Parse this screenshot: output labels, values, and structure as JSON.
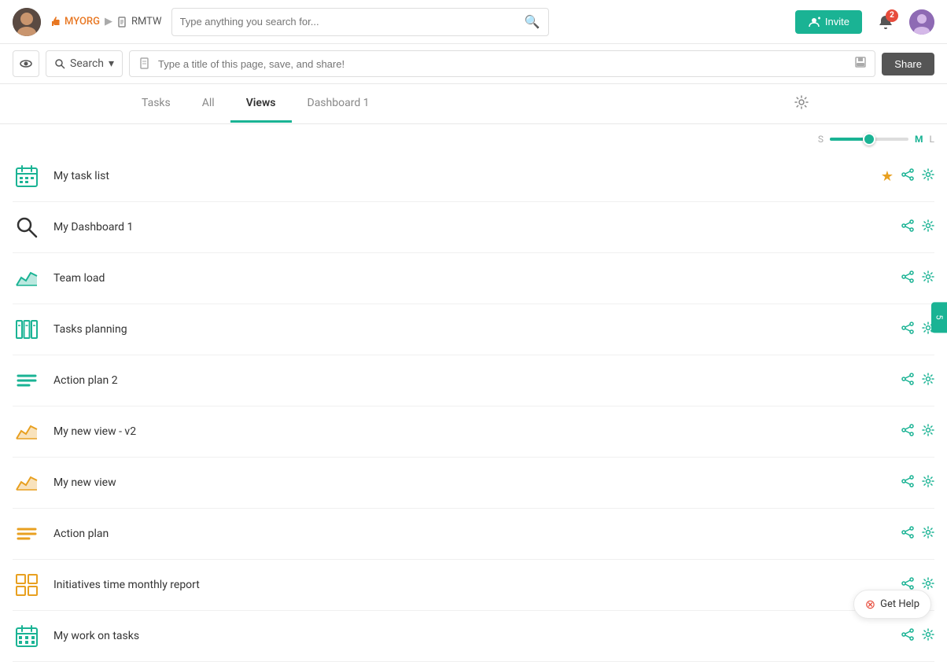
{
  "header": {
    "org_label": "MYORG",
    "breadcrumb_sep": "▶",
    "page_label": "RMTW",
    "search_placeholder": "Type anything you search for...",
    "invite_label": "Invite",
    "notif_count": "2"
  },
  "toolbar": {
    "search_label": "Search",
    "search_dropdown": "▾",
    "title_placeholder": "Type a title of this page, save, and share!",
    "share_label": "Share"
  },
  "tabs": {
    "items": [
      {
        "label": "Tasks",
        "active": false
      },
      {
        "label": "All",
        "active": false
      },
      {
        "label": "Views",
        "active": true
      },
      {
        "label": "Dashboard 1",
        "active": false
      }
    ]
  },
  "size_slider": {
    "small_label": "S",
    "medium_label": "M",
    "large_label": "L"
  },
  "views": [
    {
      "name": "My task list",
      "icon_type": "calendar",
      "icon_color": "green",
      "starred": true
    },
    {
      "name": "My Dashboard 1",
      "icon_type": "search",
      "icon_color": "dark",
      "starred": false
    },
    {
      "name": "Team load",
      "icon_type": "area-chart",
      "icon_color": "green",
      "starred": false
    },
    {
      "name": "Tasks planning",
      "icon_type": "columns",
      "icon_color": "green",
      "starred": false
    },
    {
      "name": "Action plan 2",
      "icon_type": "lines",
      "icon_color": "green",
      "starred": false
    },
    {
      "name": "My new view - v2",
      "icon_type": "area-chart",
      "icon_color": "yellow",
      "starred": false
    },
    {
      "name": "My new view",
      "icon_type": "area-chart",
      "icon_color": "yellow",
      "starred": false
    },
    {
      "name": "Action plan",
      "icon_type": "lines",
      "icon_color": "yellow",
      "starred": false
    },
    {
      "name": "Initiatives time monthly report",
      "icon_type": "grid",
      "icon_color": "yellow",
      "starred": false
    },
    {
      "name": "My work on tasks",
      "icon_type": "calendar-grid",
      "icon_color": "green",
      "starred": false
    }
  ],
  "get_help_label": "Get Help",
  "right_edge_label": "5"
}
